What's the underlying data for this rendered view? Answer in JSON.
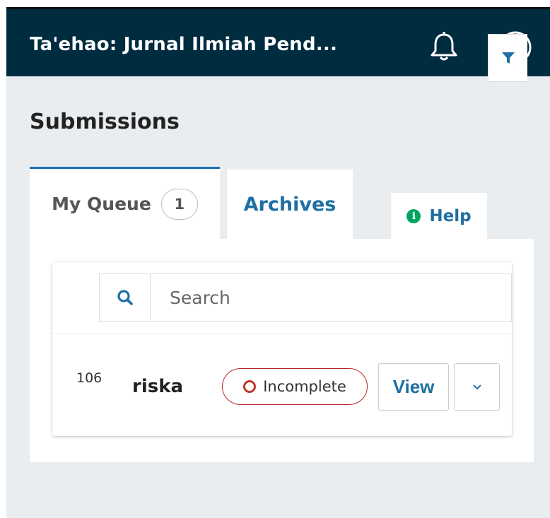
{
  "header": {
    "title": "Ta'ehao: Jurnal Ilmiah Pend...",
    "notifications_icon": "bell-icon",
    "user_icon": "user-circle-icon"
  },
  "page": {
    "title": "Submissions"
  },
  "tabs": [
    {
      "label": "My Queue",
      "count": "1",
      "active": true
    },
    {
      "label": "Archives",
      "active": false
    }
  ],
  "help": {
    "label": "Help",
    "icon": "info-icon",
    "icon_glyph": "i"
  },
  "search": {
    "placeholder": "Search",
    "value": "",
    "icon": "search-icon",
    "filter_icon": "filter-icon"
  },
  "submissions": [
    {
      "id": "106",
      "author": "riska",
      "status": "Incomplete",
      "view_label": "View",
      "expand_icon": "chevron-down-icon"
    }
  ],
  "colors": {
    "header_bg": "#002c40",
    "background": "#e9edf0",
    "accent": "#1e6fa3",
    "active_tab_border": "#1e6fb1",
    "help_icon": "#00a560",
    "status_incomplete": "#b22a2a"
  }
}
